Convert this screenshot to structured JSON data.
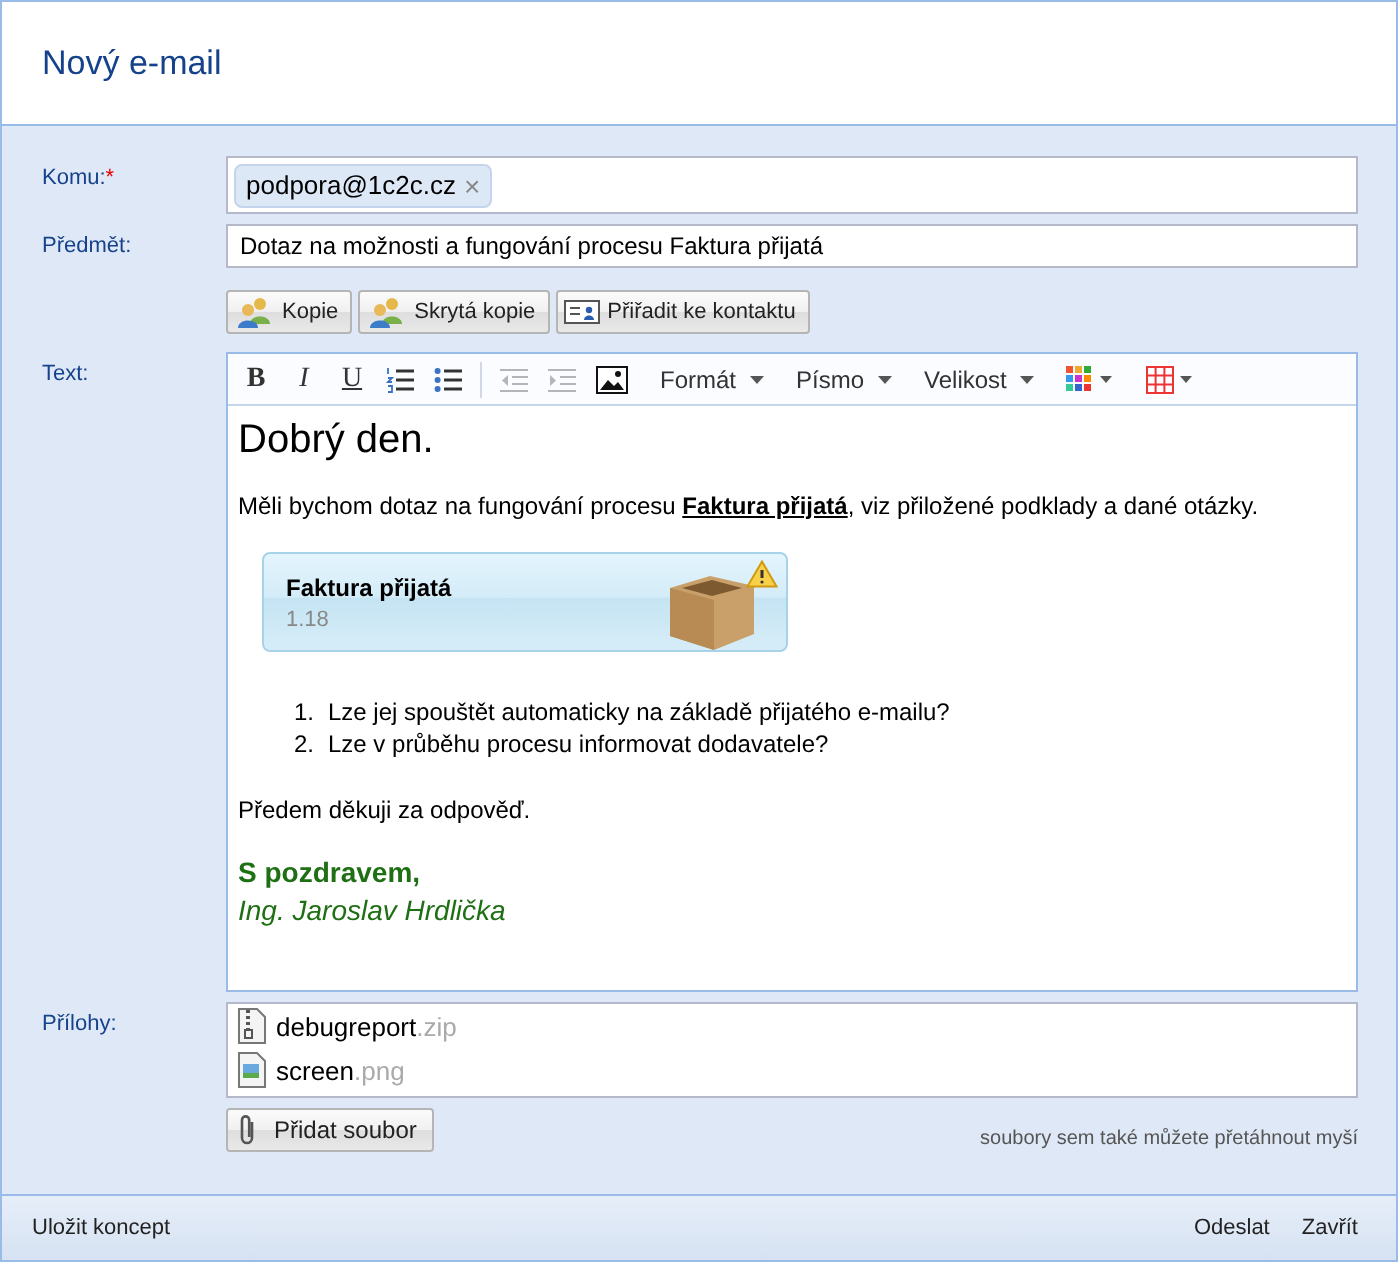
{
  "window": {
    "title": "Nový e-mail"
  },
  "to": {
    "label": "Komu:",
    "required_mark": "*",
    "recipients": [
      {
        "address": "podpora@1c2c.cz",
        "remove": "×"
      }
    ]
  },
  "subject": {
    "label": "Předmět:",
    "value": "Dotaz na možnosti a fungování procesu Faktura přijatá"
  },
  "recipient_buttons": [
    {
      "label": "Kopie",
      "kind": "people"
    },
    {
      "label": "Skrytá kopie",
      "kind": "people"
    },
    {
      "label": "Přiřadit ke kontaktu",
      "kind": "card"
    }
  ],
  "editor": {
    "label": "Text:",
    "toolbar": [
      {
        "kind": "bold",
        "label": "B",
        "disabled": false
      },
      {
        "kind": "italic",
        "label": "I",
        "disabled": false
      },
      {
        "kind": "underline",
        "label": "U",
        "disabled": false
      },
      {
        "kind": "ordered-list",
        "disabled": false
      },
      {
        "kind": "bullet-list",
        "disabled": false
      },
      {
        "kind": "separator"
      },
      {
        "kind": "outdent",
        "disabled": true
      },
      {
        "kind": "indent",
        "disabled": true
      },
      {
        "kind": "image",
        "disabled": false
      },
      {
        "kind": "dropdown",
        "label": "Formát"
      },
      {
        "kind": "dropdown",
        "label": "Písmo"
      },
      {
        "kind": "dropdown",
        "label": "Velikost"
      },
      {
        "kind": "color-dropdown"
      },
      {
        "kind": "table-dropdown"
      }
    ],
    "greeting": "Dobrý den.",
    "intro": "Měli bychom dotaz na fungování procesu **Faktura přijatá**, viz přiložené podklady a dané otázky.",
    "process_card": {
      "title": "Faktura přijatá",
      "version": "1.18",
      "warning": true
    },
    "questions": [
      {
        "number": "1.",
        "text": "Lze jej spouštět automaticky na základě přijatého e-mailu?"
      },
      {
        "number": "2.",
        "text": "Lze v průběhu procesu informovat dodavatele?"
      }
    ],
    "thanks": "Předem děkuji za odpověď.",
    "closing": "S pozdravem,",
    "signature": "Ing. Jaroslav Hrdlička"
  },
  "attachments": {
    "label": "Přílohy:",
    "files": [
      {
        "name": "debugreport",
        "ext": ".zip",
        "kind": "archive"
      },
      {
        "name": "screen",
        "ext": ".png",
        "kind": "image"
      }
    ],
    "add_button": "Přidat soubor",
    "drop_hint": "soubory sem také můžete přetáhnout myší"
  },
  "footer": {
    "save_draft": "Uložit koncept",
    "actions": [
      "Odeslat",
      "Zavřít"
    ]
  }
}
